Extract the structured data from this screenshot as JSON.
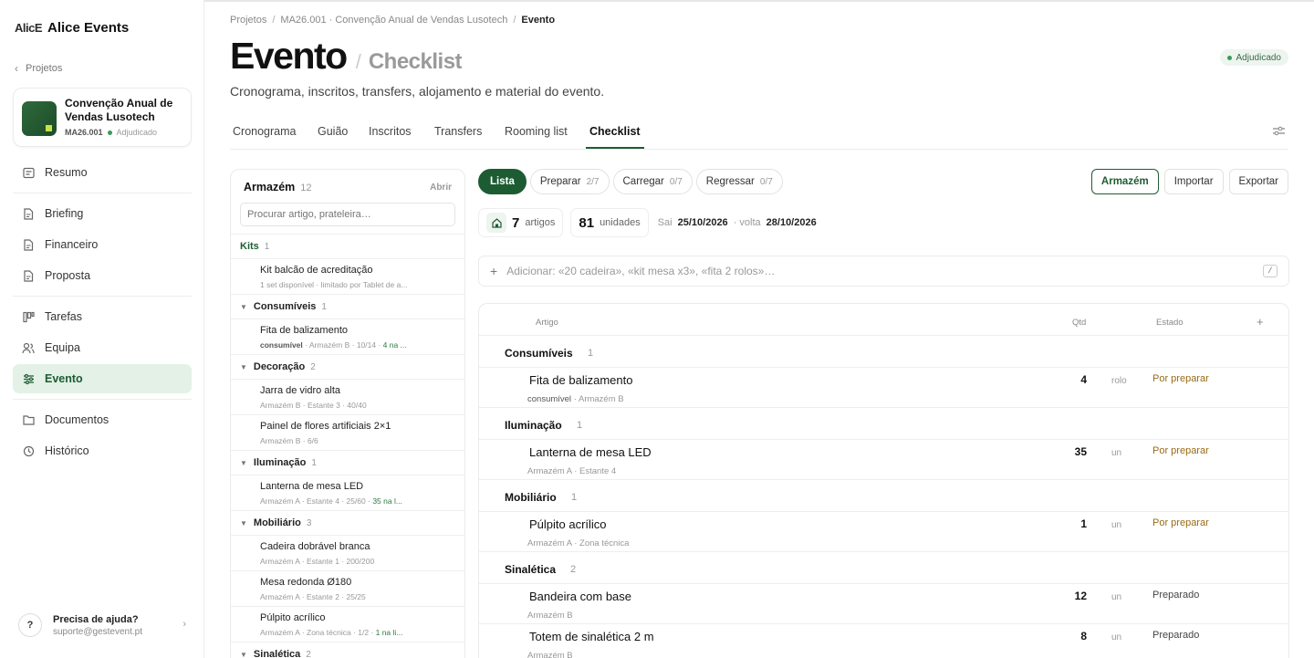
{
  "sidebar": {
    "brand_logo": "AlicE",
    "brand_name": "Alice Events",
    "back_label": "Projetos",
    "project": {
      "title": "Convenção Anual de Vendas Lusotech",
      "code": "MA26.001",
      "status": "Adjudicado"
    },
    "nav": [
      {
        "label": "Resumo",
        "icon": "summary-icon"
      },
      {
        "label": "Briefing",
        "icon": "doc-icon"
      },
      {
        "label": "Financeiro",
        "icon": "doc-icon"
      },
      {
        "label": "Proposta",
        "icon": "doc-icon"
      },
      {
        "label": "Tarefas",
        "icon": "kanban-icon"
      },
      {
        "label": "Equipa",
        "icon": "users-icon"
      },
      {
        "label": "Evento",
        "icon": "sliders-icon",
        "active": true
      },
      {
        "label": "Documentos",
        "icon": "folder-icon"
      },
      {
        "label": "Histórico",
        "icon": "history-icon"
      }
    ],
    "help": {
      "title": "Precisa de ajuda?",
      "email": "suporte@gestevent.pt"
    }
  },
  "breadcrumb": [
    "Projetos",
    "MA26.001 · Convenção Anual de Vendas Lusotech",
    "Evento"
  ],
  "header": {
    "title": "Evento",
    "subtitle": "Checklist",
    "status": "Adjudicado",
    "description": "Cronograma, inscritos, transfers, alojamento e material do evento."
  },
  "tabs": [
    "Cronograma",
    "Guião",
    "Inscritos",
    "Transfers",
    "Rooming list",
    "Checklist"
  ],
  "warehouse": {
    "title": "Armazém",
    "count": "12",
    "open_label": "Abrir",
    "search_placeholder": "Procurar artigo, prateleira…",
    "kits_label": "Kits",
    "kits_count": "1",
    "kit_item": {
      "name": "Kit balcão de acreditação",
      "meta": "1 set disponível · limitado por Tablet de a..."
    },
    "groups": [
      {
        "name": "Consumíveis",
        "count": "1",
        "items": [
          {
            "name": "Fita de balizamento",
            "tag": "consumível",
            "meta": " · Armazém B · 10/14 · ",
            "extra": "4 na ..."
          }
        ]
      },
      {
        "name": "Decoração",
        "count": "2",
        "items": [
          {
            "name": "Jarra de vidro alta",
            "meta": "Armazém B · Estante 3 · 40/40"
          },
          {
            "name": "Painel de flores artificiais 2×1",
            "meta": "Armazém B · 6/6"
          }
        ]
      },
      {
        "name": "Iluminação",
        "count": "1",
        "items": [
          {
            "name": "Lanterna de mesa LED",
            "meta": "Armazém A · Estante 4 · 25/60 · ",
            "extra": "35 na l..."
          }
        ]
      },
      {
        "name": "Mobiliário",
        "count": "3",
        "items": [
          {
            "name": "Cadeira dobrável branca",
            "meta": "Armazém A · Estante 1 · 200/200"
          },
          {
            "name": "Mesa redonda Ø180",
            "meta": "Armazém A · Estante 2 · 25/25"
          },
          {
            "name": "Púlpito acrílico",
            "meta": "Armazém A · Zona técnica · 1/2 · ",
            "extra": "1 na li..."
          }
        ]
      },
      {
        "name": "Sinalética",
        "count": "2",
        "items": []
      }
    ]
  },
  "filters": [
    {
      "label": "Lista",
      "active": true
    },
    {
      "label": "Preparar",
      "count": "2/7"
    },
    {
      "label": "Carregar",
      "count": "0/7"
    },
    {
      "label": "Regressar",
      "count": "0/7"
    }
  ],
  "actions": {
    "warehouse": "Armazém",
    "import": "Importar",
    "export": "Exportar"
  },
  "stats": {
    "items_num": "7",
    "items_label": "artigos",
    "units_num": "81",
    "units_label": "unidades",
    "out_label": "Sai",
    "out_date": "25/10/2026",
    "back_label": "· volta",
    "back_date": "28/10/2026"
  },
  "add_placeholder": "Adicionar: «20 cadeira», «kit mesa x3», «fita 2 rolos»…",
  "add_shortcut": "/",
  "table": {
    "headers": {
      "item": "Artigo",
      "qty": "Qtd",
      "state": "Estado",
      "add": "+"
    },
    "groups": [
      {
        "name": "Consumíveis",
        "count": "1",
        "rows": [
          {
            "name": "Fita de balizamento",
            "tag": "consumível",
            "meta": " · Armazém B",
            "qty": "4",
            "unit": "rolo",
            "state": "Por preparar",
            "st": "prep"
          }
        ]
      },
      {
        "name": "Iluminação",
        "count": "1",
        "rows": [
          {
            "name": "Lanterna de mesa LED",
            "meta": "Armazém A · Estante 4",
            "qty": "35",
            "unit": "un",
            "state": "Por preparar",
            "st": "prep"
          }
        ]
      },
      {
        "name": "Mobiliário",
        "count": "1",
        "rows": [
          {
            "name": "Púlpito acrílico",
            "meta": "Armazém A · Zona técnica",
            "qty": "1",
            "unit": "un",
            "state": "Por preparar",
            "st": "prep"
          }
        ]
      },
      {
        "name": "Sinalética",
        "count": "2",
        "rows": [
          {
            "name": "Bandeira com base",
            "meta": "Armazém B",
            "qty": "12",
            "unit": "un",
            "state": "Preparado",
            "st": "done"
          },
          {
            "name": "Totem de sinalética 2 m",
            "meta": "Armazém B",
            "qty": "8",
            "unit": "un",
            "state": "Preparado",
            "st": "done"
          }
        ]
      }
    ]
  }
}
